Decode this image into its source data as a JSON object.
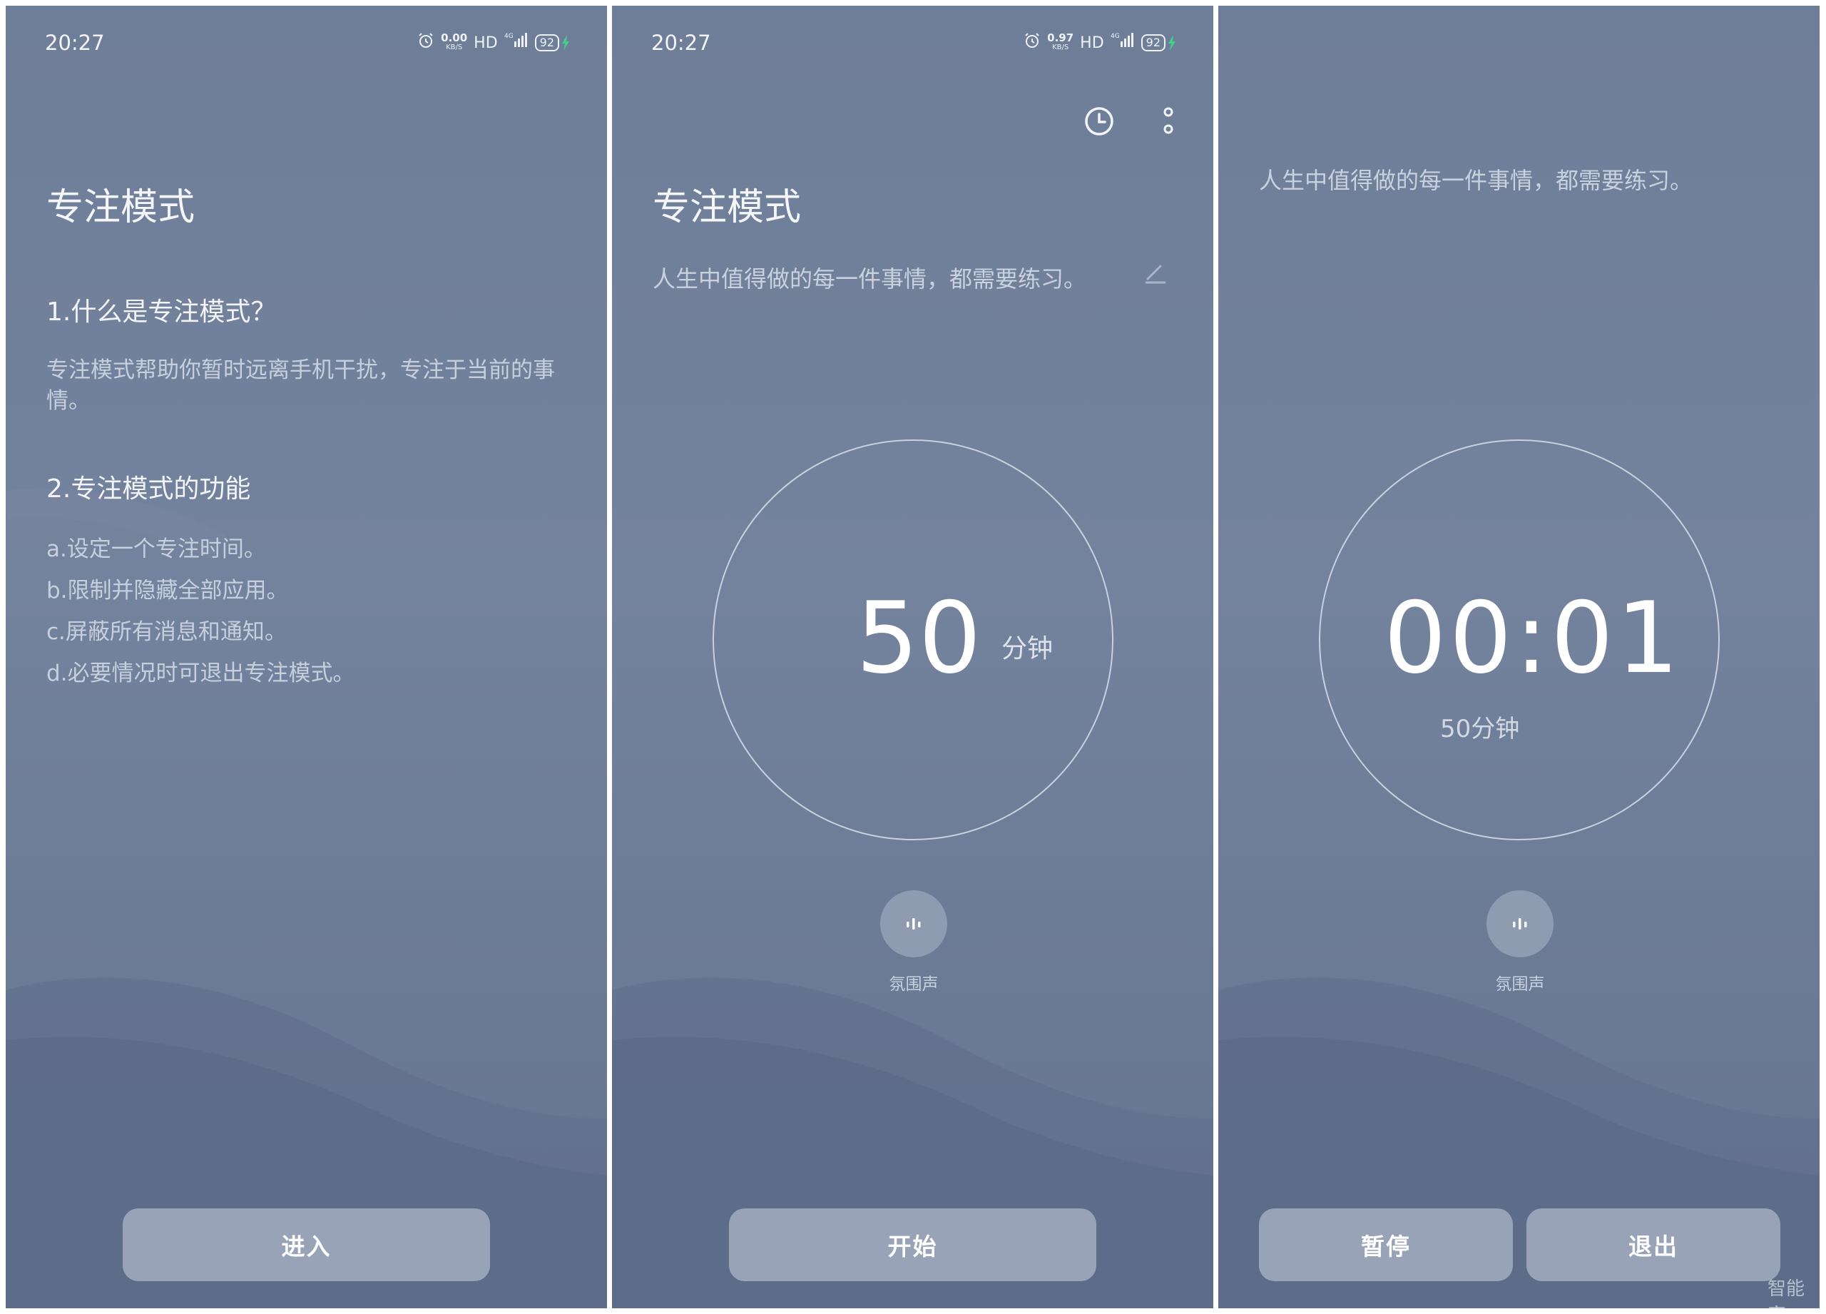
{
  "status_bar": {
    "time": "20:27",
    "panel1_speed": "0.00",
    "panel2_speed": "0.97",
    "speed_unit": "KB/S",
    "hd_label": "HD",
    "network_label": "4G",
    "battery": "92"
  },
  "intro_screen": {
    "title": "专注模式",
    "section1_title": "1.什么是专注模式？",
    "section1_text": "专注模式帮助你暂时远离手机干扰，专注于当前的事情。",
    "section2_title": "2.专注模式的功能",
    "features": [
      "a.设定一个专注时间。",
      "b.限制并隐藏全部应用。",
      "c.屏蔽所有消息和通知。",
      "d.必要情况时可退出专注模式。"
    ],
    "enter_button": "进入"
  },
  "setup_screen": {
    "title": "专注模式",
    "motto": "人生中值得做的每一件事情，都需要练习。",
    "minutes_value": "50",
    "minutes_unit": "分钟",
    "ambient_label": "氛围声",
    "start_button": "开始",
    "icons": [
      "history-clock-icon",
      "more-vertical-icon",
      "edit-pencil-icon",
      "ambient-sound-icon"
    ]
  },
  "running_screen": {
    "motto": "人生中值得做的每一件事情，都需要练习。",
    "elapsed_time": "00:01",
    "session_length": "50分钟",
    "ambient_label": "氛围声",
    "pause_button": "暂停",
    "exit_button": "退出"
  },
  "watermark": "智能家"
}
